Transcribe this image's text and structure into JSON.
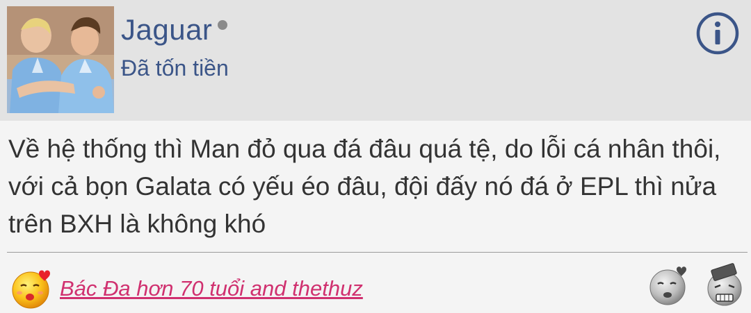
{
  "post": {
    "author": {
      "name": "Jaguar",
      "title": "Đã tốn tiền"
    },
    "content": "Về hệ thống thì Man đỏ qua đá đâu quá tệ, do lỗi cá nhân thôi, với cả bọn Galata có yếu éo đâu, đội đấy nó đá ở EPL thì nửa trên BXH là không khó",
    "likes": {
      "text": "Bác Đa hơn 70 tuổi and thethuz"
    }
  },
  "icons": {
    "info": "info-icon",
    "love": "love-emoji-icon",
    "kiss": "kiss-emoji-icon",
    "brick": "brick-emoji-icon"
  },
  "colors": {
    "header_bg": "#e3e3e3",
    "author": "#3b5588",
    "likers": "#d0306f",
    "text": "#333333"
  }
}
